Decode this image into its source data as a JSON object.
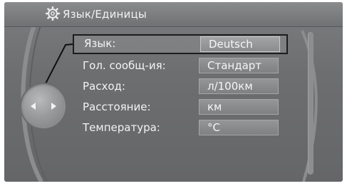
{
  "title": {
    "icon": "gear-icon",
    "text": "Язык/Единицы"
  },
  "settings": [
    {
      "label": "Язык:",
      "value": "Deutsch",
      "selected": true
    },
    {
      "label": "Гол. сообщ-ия:",
      "value": "Стандарт",
      "selected": false
    },
    {
      "label": "Расход:",
      "value": "л/100км",
      "selected": false
    },
    {
      "label": "Расстояние:",
      "value": "км",
      "selected": false
    },
    {
      "label": "Температура:",
      "value": "°C",
      "selected": false
    }
  ],
  "controller": {
    "icon": "controller-knob-icon"
  },
  "colors": {
    "screen": "#6e6f71",
    "text": "#f4f4f4",
    "highlight": "#1d1d1f"
  }
}
